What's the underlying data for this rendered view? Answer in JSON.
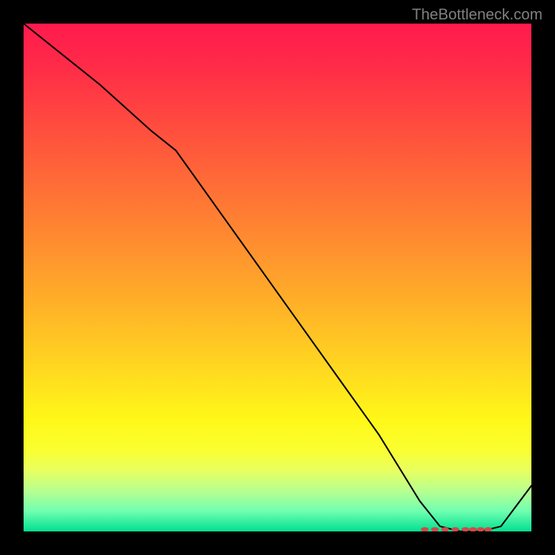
{
  "watermark": "TheBottleneck.com",
  "chart_data": {
    "type": "line",
    "title": "",
    "xlabel": "",
    "ylabel": "",
    "xlim": [
      0,
      100
    ],
    "ylim": [
      0,
      100
    ],
    "series": [
      {
        "name": "curve",
        "x": [
          0,
          15,
          25,
          30,
          40,
          50,
          60,
          70,
          78,
          82,
          86,
          90,
          94,
          100
        ],
        "values": [
          100,
          88,
          79,
          75,
          61,
          47,
          33,
          19,
          6,
          1,
          0,
          0,
          1,
          9
        ]
      }
    ],
    "markers": {
      "name": "bottom-cluster",
      "x": [
        79,
        81,
        83,
        85,
        87,
        88.5,
        90,
        91.5
      ],
      "values": [
        0.4,
        0.4,
        0.4,
        0.4,
        0.4,
        0.4,
        0.4,
        0.4
      ]
    }
  }
}
